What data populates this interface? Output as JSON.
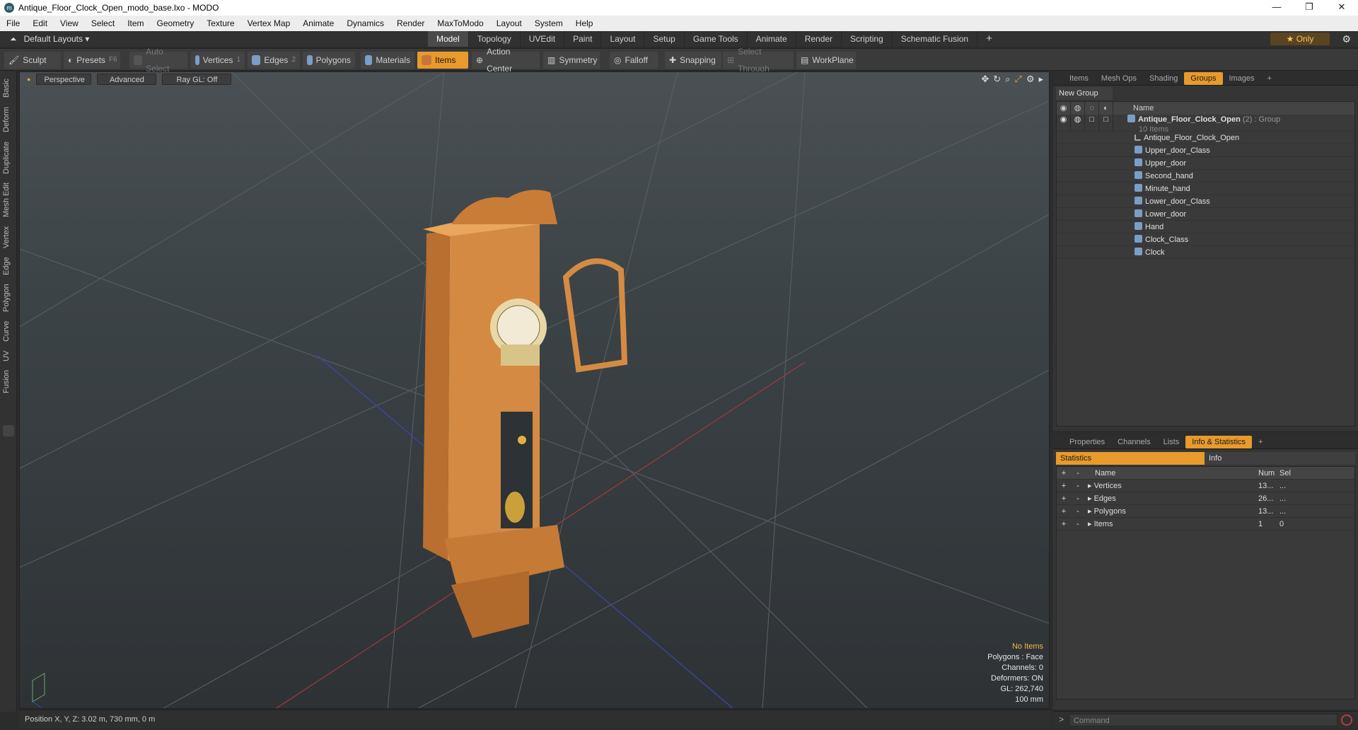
{
  "window": {
    "title": "Antique_Floor_Clock_Open_modo_base.lxo - MODO",
    "minimize": "—",
    "maximize": "❐",
    "close": "✕"
  },
  "menu": [
    "File",
    "Edit",
    "View",
    "Select",
    "Item",
    "Geometry",
    "Texture",
    "Vertex Map",
    "Animate",
    "Dynamics",
    "Render",
    "MaxToModo",
    "Layout",
    "System",
    "Help"
  ],
  "layoutbar": {
    "default_layouts": "Default Layouts ▾",
    "tabs": [
      "Model",
      "Topology",
      "UVEdit",
      "Paint",
      "Layout",
      "Setup",
      "Game Tools",
      "Animate",
      "Render",
      "Scripting",
      "Schematic Fusion"
    ],
    "active_tab": "Model",
    "add": "+",
    "only": "★  Only"
  },
  "toolbar": {
    "sculpt": "Sculpt",
    "presets": "Presets",
    "presets_key": "F6",
    "auto_select": "Auto Select",
    "vertices": "Vertices",
    "vertices_num": "1",
    "edges": "Edges",
    "edges_num": "2",
    "polygons": "Polygons",
    "materials": "Materials",
    "items": "Items",
    "action_center": "Action Center",
    "symmetry": "Symmetry",
    "falloff": "Falloff",
    "snapping": "Snapping",
    "select_through": "Select Through",
    "workplane": "WorkPlane"
  },
  "left_tabs": [
    "Basic",
    "Deform",
    "Duplicate",
    "Mesh Edit",
    "Vertex",
    "Edge",
    "Polygon",
    "Curve",
    "UV",
    "Fusion"
  ],
  "viewport": {
    "perspective": "Perspective",
    "advanced": "Advanced",
    "raygl": "Ray GL: Off",
    "stats": {
      "no_items": "No Items",
      "polygons": "Polygons : Face",
      "channels": "Channels: 0",
      "deformers": "Deformers: ON",
      "gl": "GL: 262,740",
      "scale": "100 mm"
    }
  },
  "status": {
    "position": "Position X, Y, Z:  3.02 m, 730 mm, 0 m"
  },
  "right_top": {
    "tabs": [
      "Items",
      "Mesh Ops",
      "Shading",
      "Groups",
      "Images"
    ],
    "active_tab": "Groups",
    "new_group": "New Group",
    "col_name": "Name",
    "group": {
      "name": "Antique_Floor_Clock_Open",
      "count": "(2)",
      "type": ": Group",
      "items_count": "10 Items"
    },
    "children": [
      "Antique_Floor_Clock_Open",
      "Upper_door_Class",
      "Upper_door",
      "Second_hand",
      "Minute_hand",
      "Lower_door_Class",
      "Lower_door",
      "Hand",
      "Clock_Class",
      "Clock"
    ]
  },
  "right_bottom": {
    "tabs": [
      "Properties",
      "Channels",
      "Lists",
      "Info & Statistics"
    ],
    "active_tab": "Info & Statistics",
    "stat_tab": "Statistics",
    "info_tab": "Info",
    "cols": {
      "name": "Name",
      "num": "Num",
      "sel": "Sel"
    },
    "rows": [
      {
        "name": "Vertices",
        "num": "13...",
        "sel": "..."
      },
      {
        "name": "Edges",
        "num": "26...",
        "sel": "..."
      },
      {
        "name": "Polygons",
        "num": "13...",
        "sel": "..."
      },
      {
        "name": "Items",
        "num": "1",
        "sel": "0"
      }
    ]
  },
  "command": {
    "placeholder": "Command"
  },
  "colors": {
    "accent": "#e89a2c",
    "wood": "#d9914a"
  }
}
